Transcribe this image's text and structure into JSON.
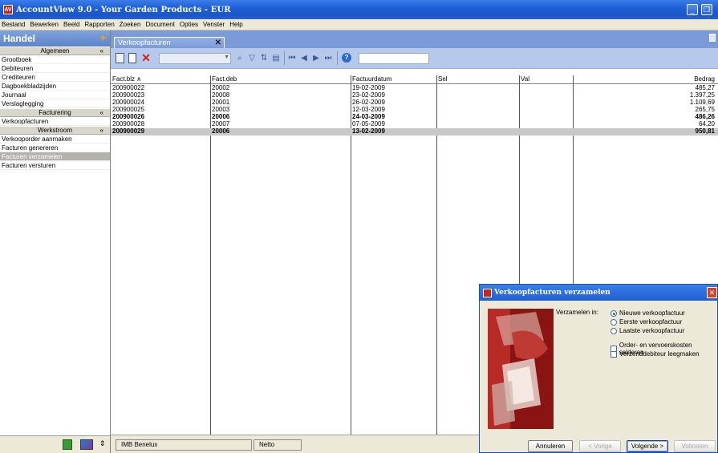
{
  "window": {
    "title": "AccountView 9.0 - Your Garden Products - EUR"
  },
  "menu": [
    "Bestand",
    "Bewerken",
    "Beeld",
    "Rapporten",
    "Zoeken",
    "Document",
    "Opties",
    "Venster",
    "Help"
  ],
  "left": {
    "title": "Handel",
    "groups": [
      {
        "title": "Algemeen",
        "items": [
          "Grootboek",
          "Debiteuren",
          "Crediteuren",
          "Dagboekbladzijden",
          "Journaal",
          "Verslaglegging"
        ]
      },
      {
        "title": "Facturering",
        "items": [
          "Verkoopfacturen"
        ]
      },
      {
        "title": "Werkstroom",
        "items": [
          "Verkooporder aanmaken",
          "Facturen genereren",
          "Facturen verzamelen",
          "Facturen versturen"
        ]
      }
    ],
    "selected_item": "Facturen verzamelen"
  },
  "tab": {
    "label": "Verkoopfacturen"
  },
  "grid": {
    "columns": [
      "Fact.blz",
      "Fact.deb",
      "Factuurdatum",
      "Sel",
      "Val",
      "Bedrag"
    ],
    "sort_indicator": "∧",
    "rows": [
      {
        "blz": "200900022",
        "deb": "20002",
        "datum": "19-02-2009",
        "sel": "",
        "val": "",
        "bedrag": "485,27",
        "bold": false,
        "selected": false
      },
      {
        "blz": "200900023",
        "deb": "20008",
        "datum": "23-02-2009",
        "sel": "",
        "val": "",
        "bedrag": "1.397,25",
        "bold": false,
        "selected": false
      },
      {
        "blz": "200900024",
        "deb": "20001",
        "datum": "26-02-2009",
        "sel": "",
        "val": "",
        "bedrag": "1.109,69",
        "bold": false,
        "selected": false
      },
      {
        "blz": "200900025",
        "deb": "20003",
        "datum": "12-03-2009",
        "sel": "",
        "val": "",
        "bedrag": "265,75",
        "bold": false,
        "selected": false
      },
      {
        "blz": "200900026",
        "deb": "20006",
        "datum": "24-03-2009",
        "sel": "",
        "val": "",
        "bedrag": "486,26",
        "bold": true,
        "selected": false
      },
      {
        "blz": "200900028",
        "deb": "20007",
        "datum": "07-05-2009",
        "sel": "",
        "val": "",
        "bedrag": "64,20",
        "bold": false,
        "selected": false
      },
      {
        "blz": "200900029",
        "deb": "20006",
        "datum": "13-02-2009",
        "sel": "",
        "val": "",
        "bedrag": "950,81",
        "bold": true,
        "selected": true
      }
    ]
  },
  "status": {
    "company": "IMB Benelux",
    "mode": "Netto"
  },
  "dialog": {
    "title": "Verkoopfacturen verzamelen",
    "verzamelen_label": "Verzamelen in:",
    "radios": [
      {
        "label": "Nieuwe verkoopfactuur",
        "checked": true
      },
      {
        "label": "Eerste verkoopfactuur",
        "checked": false
      },
      {
        "label": "Laatste verkoopfactuur",
        "checked": false
      }
    ],
    "checks": [
      {
        "label": "Order- en vervoerskosten salderen",
        "checked": false
      },
      {
        "label": "Verzenddebiteur leegmaken",
        "checked": false
      }
    ],
    "buttons": {
      "cancel": "Annuleren",
      "prev": "< Vorige",
      "next": "Volgende >",
      "finish": "Voltooien"
    }
  },
  "colors": {
    "accent": "#1f5fd6",
    "toolbar": "#b7c9ea",
    "delete": "#d02020",
    "dialog_image": "#9c1a18"
  }
}
